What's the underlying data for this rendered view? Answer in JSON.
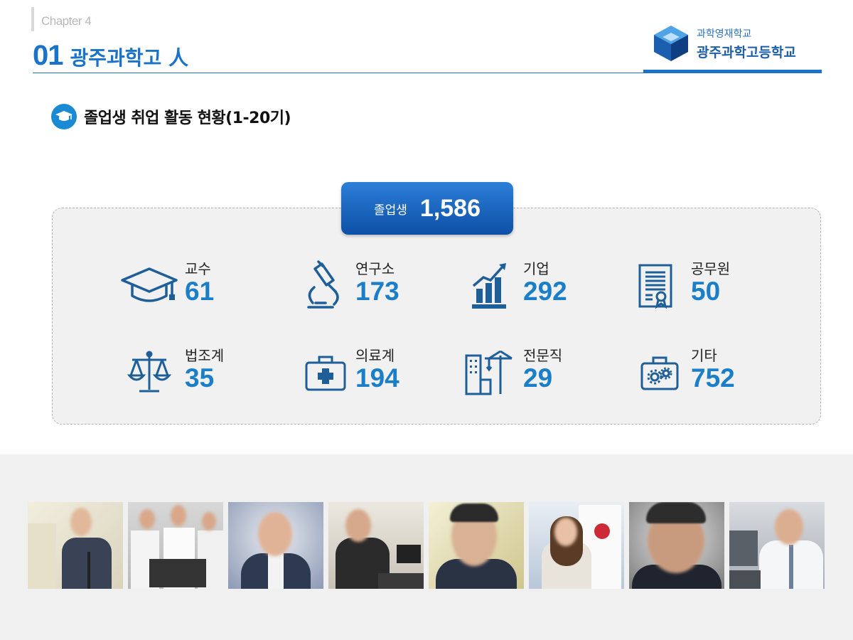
{
  "header": {
    "chapter": "Chapter 4",
    "number": "01",
    "title": "광주과학고 人"
  },
  "logo": {
    "top": "과학영재학교",
    "bottom": "광주과학고등학교"
  },
  "section": {
    "title": "졸업생 취업 활동 현황(1-20기)",
    "icon": "graduation-cap-icon"
  },
  "total": {
    "label": "졸업생",
    "value": "1,586"
  },
  "stats": [
    {
      "label": "교수",
      "value": "61",
      "icon": "graduation-cap-icon"
    },
    {
      "label": "연구소",
      "value": "173",
      "icon": "microscope-icon"
    },
    {
      "label": "기업",
      "value": "292",
      "icon": "bar-chart-growth-icon"
    },
    {
      "label": "공무원",
      "value": "50",
      "icon": "certificate-icon"
    },
    {
      "label": "법조계",
      "value": "35",
      "icon": "scales-icon"
    },
    {
      "label": "의료계",
      "value": "194",
      "icon": "medical-kit-icon"
    },
    {
      "label": "전문직",
      "value": "29",
      "icon": "building-crane-icon"
    },
    {
      "label": "기타",
      "value": "752",
      "icon": "gear-briefcase-icon"
    }
  ],
  "colors": {
    "accent": "#1a73c8",
    "value": "#1a7fc8",
    "icon": "#1f5f99",
    "panel": "#f1f1f1"
  }
}
